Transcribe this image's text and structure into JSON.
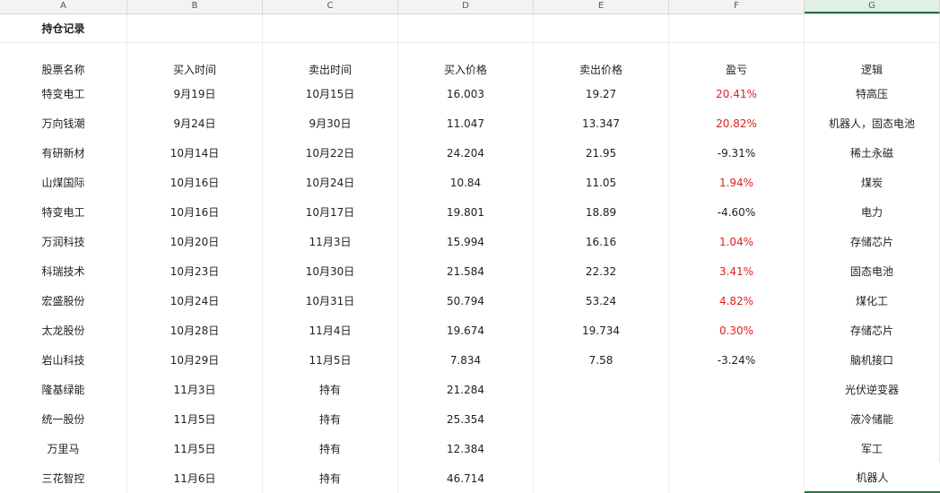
{
  "columns": [
    "A",
    "B",
    "C",
    "D",
    "E",
    "F",
    "G"
  ],
  "selected_column": "G",
  "title": "持仓记录",
  "headers": [
    "股票名称",
    "买入时间",
    "卖出时间",
    "买入价格",
    "卖出价格",
    "盈亏",
    "逻辑"
  ],
  "rows": [
    [
      "特变电工",
      "9月19日",
      "10月15日",
      "16.003",
      "19.27",
      "20.41%",
      "特高压"
    ],
    [
      "万向钱潮",
      "9月24日",
      "9月30日",
      "11.047",
      "13.347",
      "20.82%",
      "机器人，固态电池"
    ],
    [
      "有研新材",
      "10月14日",
      "10月22日",
      "24.204",
      "21.95",
      "-9.31%",
      "稀土永磁"
    ],
    [
      "山煤国际",
      "10月16日",
      "10月24日",
      "10.84",
      "11.05",
      "1.94%",
      "煤炭"
    ],
    [
      "特变电工",
      "10月16日",
      "10月17日",
      "19.801",
      "18.89",
      "-4.60%",
      "电力"
    ],
    [
      "万润科技",
      "10月20日",
      "11月3日",
      "15.994",
      "16.16",
      "1.04%",
      "存储芯片"
    ],
    [
      "科瑞技术",
      "10月23日",
      "10月30日",
      "21.584",
      "22.32",
      "3.41%",
      "固态电池"
    ],
    [
      "宏盛股份",
      "10月24日",
      "10月31日",
      "50.794",
      "53.24",
      "4.82%",
      "煤化工"
    ],
    [
      "太龙股份",
      "10月28日",
      "11月4日",
      "19.674",
      "19.734",
      "0.30%",
      "存储芯片"
    ],
    [
      "岩山科技",
      "10月29日",
      "11月5日",
      "7.834",
      "7.58",
      "-3.24%",
      "脑机接口"
    ],
    [
      "隆基绿能",
      "11月3日",
      "持有",
      "21.284",
      "",
      "",
      "光伏逆变器"
    ],
    [
      "统一股份",
      "11月5日",
      "持有",
      "25.354",
      "",
      "",
      "液冷储能"
    ],
    [
      "万里马",
      "11月5日",
      "持有",
      "12.384",
      "",
      "",
      "军工"
    ],
    [
      "三花智控",
      "11月6日",
      "持有",
      "46.714",
      "",
      "",
      "机器人"
    ]
  ],
  "colors": {
    "positive": "#e0201c",
    "negative": "#1f1f1f",
    "selection": "#217346"
  }
}
